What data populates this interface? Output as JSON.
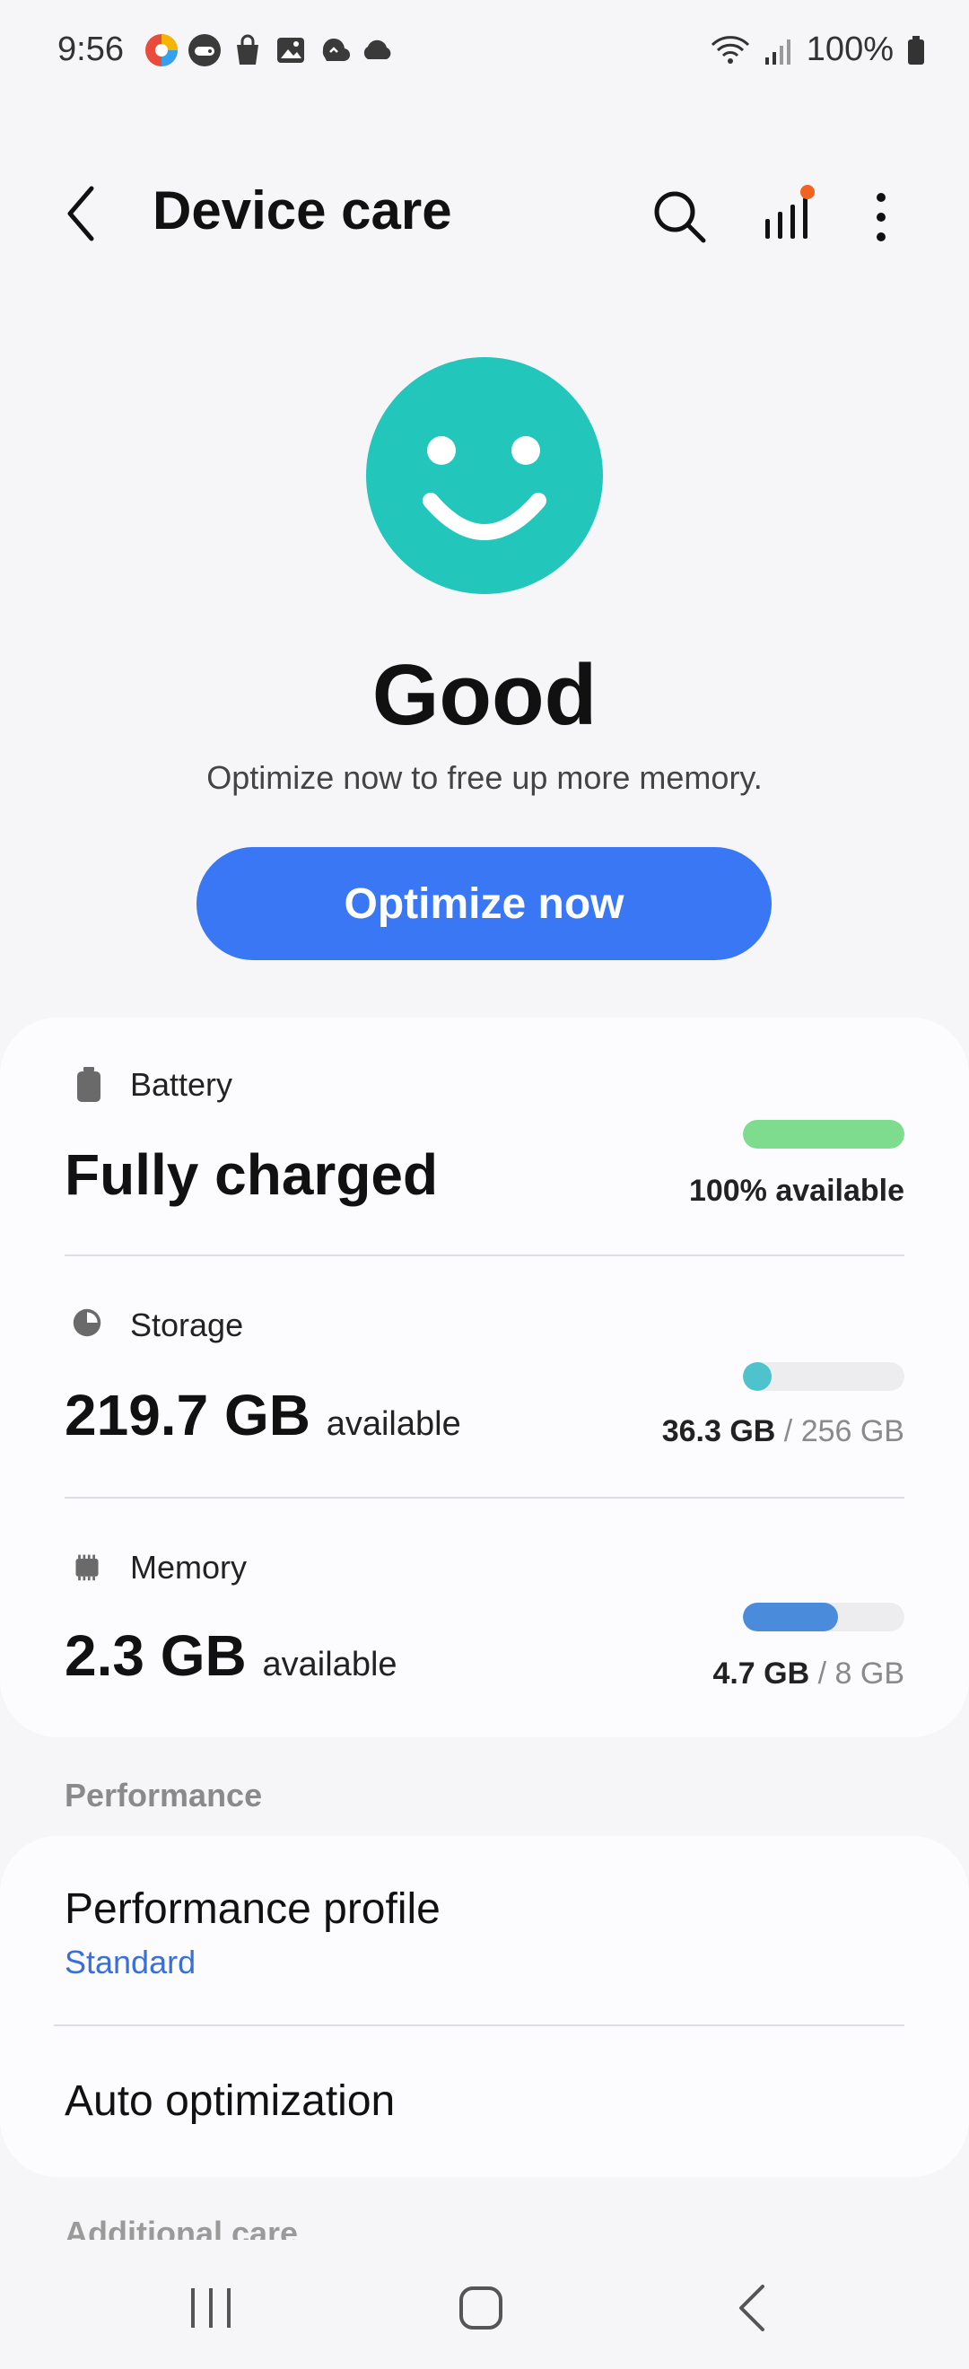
{
  "status_bar": {
    "time": "9:56",
    "battery": "100%",
    "icons": [
      "app-icon",
      "game-icon",
      "shopping-bag-icon",
      "gallery-icon",
      "sync-icon",
      "cloud-icon",
      "wifi-icon",
      "signal-icon",
      "battery-icon"
    ]
  },
  "app_bar": {
    "title": "Device care"
  },
  "status": {
    "word": "Good",
    "subtitle": "Optimize now to free up more memory.",
    "face_color": "#22c6bb",
    "button_label": "Optimize now"
  },
  "battery": {
    "label": "Battery",
    "value": "Fully charged",
    "right": "100% available",
    "level": 1.0,
    "color": "#7ddc8e"
  },
  "storage": {
    "label": "Storage",
    "value": "219.7 GB",
    "suffix": "available",
    "used": "36.3 GB",
    "sep": " / ",
    "total": "256 GB",
    "level": 0.142,
    "color": "#4fc3cd"
  },
  "memory": {
    "label": "Memory",
    "value": "2.3 GB",
    "suffix": "available",
    "used": "4.7 GB",
    "sep": " / ",
    "total": "8 GB",
    "level": 0.5875,
    "color": "#4a8bdb"
  },
  "performance": {
    "section_label": "Performance",
    "profile_title": "Performance profile",
    "profile_value": "Standard",
    "auto_title": "Auto optimization"
  },
  "additional": {
    "section_label": "Additional care"
  },
  "nav": {
    "icons": [
      "recent-apps-icon",
      "home-icon",
      "back-icon"
    ]
  }
}
